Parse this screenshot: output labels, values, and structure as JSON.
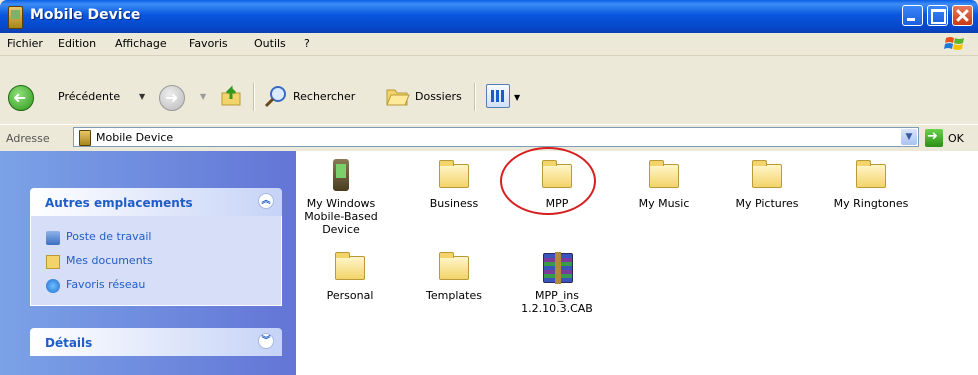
{
  "window": {
    "title": "Mobile Device"
  },
  "menu": [
    "Fichier",
    "Edition",
    "Affichage",
    "Favoris",
    "Outils",
    "?"
  ],
  "toolbar": {
    "back_label": "Précédente",
    "search_label": "Rechercher",
    "folders_label": "Dossiers"
  },
  "address": {
    "label": "Adresse",
    "value": "Mobile Device",
    "go_label": "OK"
  },
  "taskpane": {
    "other_places": {
      "title": "Autres emplacements",
      "links": [
        "Poste de travail",
        "Mes documents",
        "Favoris réseau"
      ]
    },
    "details": {
      "title": "Détails"
    }
  },
  "items": [
    {
      "name": "My Windows Mobile-Based Device",
      "lines": [
        "My Windows",
        "Mobile-Based",
        "Device"
      ],
      "icon": "pda-icon"
    },
    {
      "name": "Business",
      "lines": [
        "Business"
      ],
      "icon": "folder-icon"
    },
    {
      "name": "MPP",
      "lines": [
        "MPP"
      ],
      "icon": "folder-icon",
      "highlighted": true
    },
    {
      "name": "My Music",
      "lines": [
        "My Music"
      ],
      "icon": "folder-icon"
    },
    {
      "name": "My Pictures",
      "lines": [
        "My Pictures"
      ],
      "icon": "folder-icon"
    },
    {
      "name": "My Ringtones",
      "lines": [
        "My Ringtones"
      ],
      "icon": "folder-icon"
    },
    {
      "name": "Personal",
      "lines": [
        "Personal"
      ],
      "icon": "folder-icon"
    },
    {
      "name": "Templates",
      "lines": [
        "Templates"
      ],
      "icon": "folder-icon"
    },
    {
      "name": "MPP_ins 1.2.10.3.CAB",
      "lines": [
        "MPP_ins",
        "1.2.10.3.CAB"
      ],
      "icon": "archive-icon"
    }
  ],
  "colors": {
    "titlebar": "#0646c8",
    "taskpane": "#7ba2e7",
    "annotation_circle": "#d71f1f",
    "link": "#215dc6"
  }
}
